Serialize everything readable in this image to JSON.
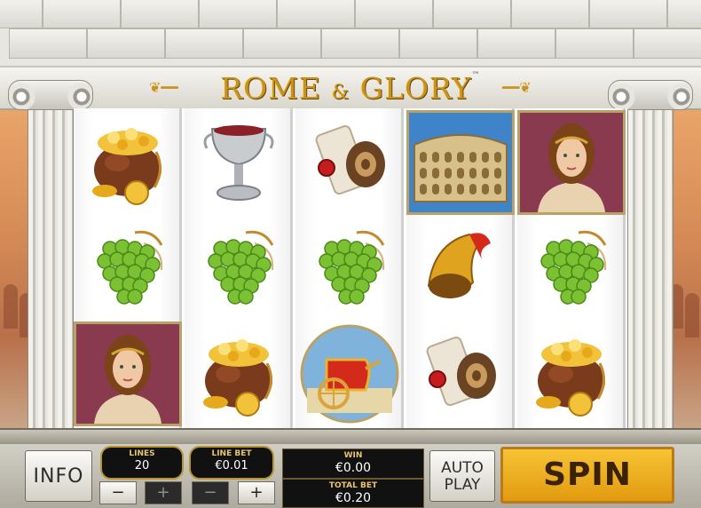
{
  "game": {
    "title_part1": "ROME",
    "title_amp": "&",
    "title_part2": "GLORY",
    "trademark": "™"
  },
  "reels": [
    [
      "gold-pot",
      "grapes",
      "goddess"
    ],
    [
      "silver-chalice",
      "grapes",
      "gold-pot"
    ],
    [
      "scroll",
      "grapes",
      "chariot"
    ],
    [
      "colosseum",
      "war-horn",
      "scroll"
    ],
    [
      "goddess",
      "grapes",
      "gold-pot"
    ]
  ],
  "controls": {
    "info_label": "INFO",
    "lines_label": "LINES",
    "lines_value": "20",
    "line_bet_label": "LINE BET",
    "line_bet_value": "€0.01",
    "minus_label": "−",
    "plus_label": "+",
    "win_label": "WIN",
    "win_value": "€0.00",
    "total_bet_label": "TOTAL BET",
    "total_bet_value": "€0.20",
    "auto_play_line1": "AUTO",
    "auto_play_line2": "PLAY",
    "spin_label": "SPIN"
  },
  "colors": {
    "gold": "#c9921d",
    "spin_button": "#f0ae1c",
    "panel_black": "#111111",
    "marble": "#e8e6e0"
  }
}
